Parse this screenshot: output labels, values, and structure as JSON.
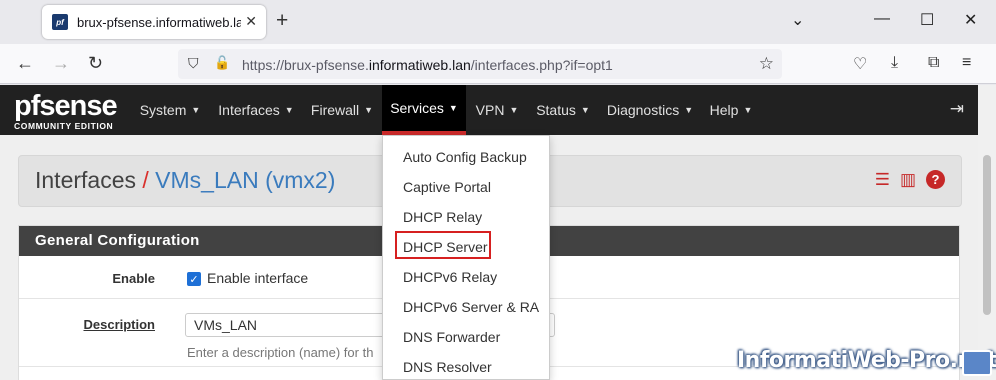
{
  "browser": {
    "tab_title": "brux-pfsense.informatiweb.lan",
    "favicon_text": "pf",
    "url_prefix": "https://brux-pfsense.",
    "url_domain": "informatiweb.lan",
    "url_path": "/interfaces.php?if=opt1",
    "icons": [
      "close-icon",
      "plus-icon",
      "chevron-down-icon",
      "minimize-icon",
      "maximize-icon",
      "close-window-icon",
      "back-icon",
      "forward-icon",
      "reload-icon",
      "shield-icon",
      "lock-icon",
      "star-icon",
      "pocket-icon",
      "download-icon",
      "extensions-icon",
      "menu-icon"
    ]
  },
  "logo": {
    "brand": "pfsense",
    "edition": "COMMUNITY EDITION"
  },
  "menu": {
    "items": [
      {
        "label": "System"
      },
      {
        "label": "Interfaces"
      },
      {
        "label": "Firewall"
      },
      {
        "label": "Services"
      },
      {
        "label": "VPN"
      },
      {
        "label": "Status"
      },
      {
        "label": "Diagnostics"
      },
      {
        "label": "Help"
      }
    ],
    "active": "Services"
  },
  "breadcrumb": {
    "section": "Interfaces",
    "separator": "/",
    "page": "VMs_LAN (vmx2)"
  },
  "panel": {
    "title": "General Configuration",
    "enable_label": "Enable",
    "enable_checkbox_label": "Enable interface",
    "enable_checked": true,
    "description_label": "Description",
    "description_value": "VMs_LAN",
    "description_help": "Enter a description (name) for th"
  },
  "services_dropdown": {
    "items": [
      "Auto Config Backup",
      "Captive Portal",
      "DHCP Relay",
      "DHCP Server",
      "DHCPv6 Relay",
      "DHCPv6 Server & RA",
      "DNS Forwarder",
      "DNS Resolver"
    ],
    "highlighted": "DHCP Server",
    "highlight_color": "#d62020"
  },
  "watermark": "InformatiWeb-Pro.net",
  "colors": {
    "pf_bar": "#212121",
    "active_underline": "#cc2a2a",
    "breadcrumb_accent": "#d9302c",
    "link_blue": "#3a7bbd"
  }
}
